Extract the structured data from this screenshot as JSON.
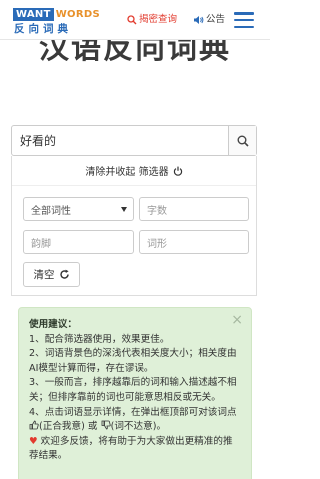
{
  "header": {
    "logo_want": "WANT",
    "logo_words": "WORDS",
    "logo_cn": "反向词典",
    "nav_hidden": "揭密查询",
    "nav_notice": "公告"
  },
  "page": {
    "title": "汉语反向词典"
  },
  "search": {
    "value": "好看的"
  },
  "filter": {
    "toggle_label": "清除并收起 筛选器",
    "pos_select": "全部词性",
    "chars_placeholder": "字数",
    "rhyme_placeholder": "韵脚",
    "shape_placeholder": "词形",
    "clear_label": "清空"
  },
  "tips": {
    "close": "×",
    "title": "使用建议：",
    "item1": "1、配合筛选器使用，效果更佳。",
    "item2": "2、词语背景色的深浅代表相关度大小；相关度由AI模型计算而得，存在谬误。",
    "item3": "3、一般而言，排序越靠后的词和输入描述越不相关；但排序靠前的词也可能意思相反或无关。",
    "item4_a": "4、点击词语显示详情，在弹出框顶部可对该词点",
    "item4_b": "(正合我意) 或",
    "item4_c": "(词不达意)。",
    "feedback": "欢迎多反馈，将有助于为大家做出更精准的推荐结果。"
  },
  "colors": {
    "brand_blue": "#2a6bb8",
    "brand_orange": "#e8912b",
    "alert_red": "#e23b2e",
    "tips_bg": "#dff0d8"
  }
}
